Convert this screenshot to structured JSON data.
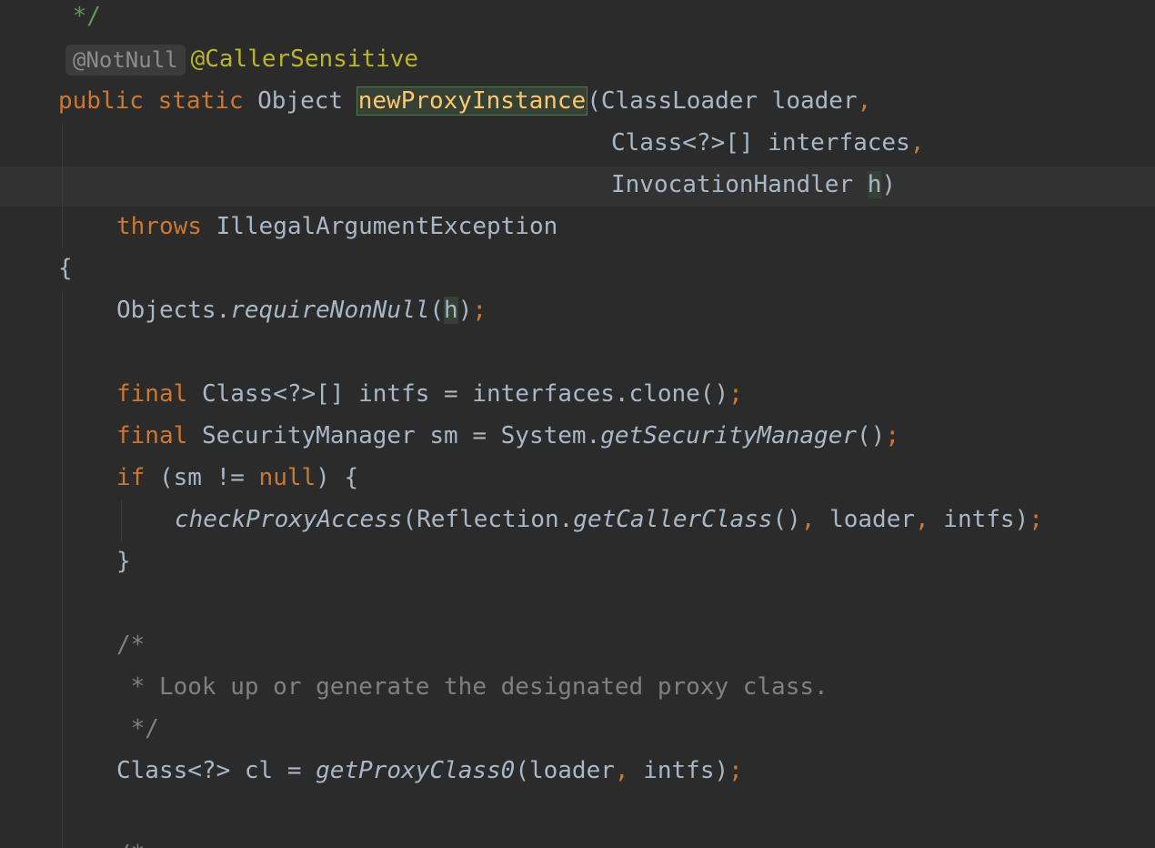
{
  "editor": {
    "colors": {
      "background": "#2b2b2b",
      "keyword": "#cc7832",
      "annotation": "#bbb529",
      "comment": "#808080",
      "doc_comment": "#629755",
      "method_decl": "#ffc66d",
      "text": "#a9b7c6"
    },
    "lines": [
      {
        "doc_end": " */"
      },
      {
        "inlay_hint": "@NotNull",
        "annotation": "@CallerSensitive"
      },
      {
        "kw_public": "public",
        "kw_static": "static",
        "return_type": "Object",
        "method_name": "newProxyInstance",
        "params": "(ClassLoader loader",
        "comma": ","
      },
      {
        "param": "Class<?>[] interfaces",
        "comma": ","
      },
      {
        "param_prefix": "InvocationHandler ",
        "param_var": "h",
        "close": ")"
      },
      {
        "kw_throws": "throws",
        "exception": "IllegalArgumentException"
      },
      {
        "brace_open": "{"
      },
      {
        "prefix": "Objects.",
        "method": "requireNonNull",
        "open": "(",
        "arg": "h",
        "close": ")",
        "semi": ";"
      },
      {
        "kw_final": "final",
        "rest": "Class<?>[] intfs = interfaces.clone()",
        "semi": ";"
      },
      {
        "kw_final": "final",
        "rest": "SecurityManager sm = System.",
        "method": "getSecurityManager",
        "call": "()",
        "semi": ";"
      },
      {
        "kw_if": "if",
        "cond_a": "(sm != ",
        "kw_null": "null",
        "cond_b": ") {"
      },
      {
        "method": "checkProxyAccess",
        "arg_a": "(Reflection.",
        "method2": "getCallerClass",
        "call": "()",
        "comma1": ",",
        "arg_b": " loader",
        "comma2": ",",
        "arg_c": " intfs)",
        "semi": ";"
      },
      {
        "brace_close": "}"
      },
      {
        "comment_open": "/*"
      },
      {
        "comment_body": " * Look up or generate the designated proxy class."
      },
      {
        "comment_close": " */"
      },
      {
        "prefix": "Class<?> cl = ",
        "method": "getProxyClass0",
        "args_a": "(loader",
        "comma": ",",
        "args_b": " intfs)",
        "semi": ";"
      },
      {
        "comment_open_partial": "/*"
      }
    ]
  }
}
